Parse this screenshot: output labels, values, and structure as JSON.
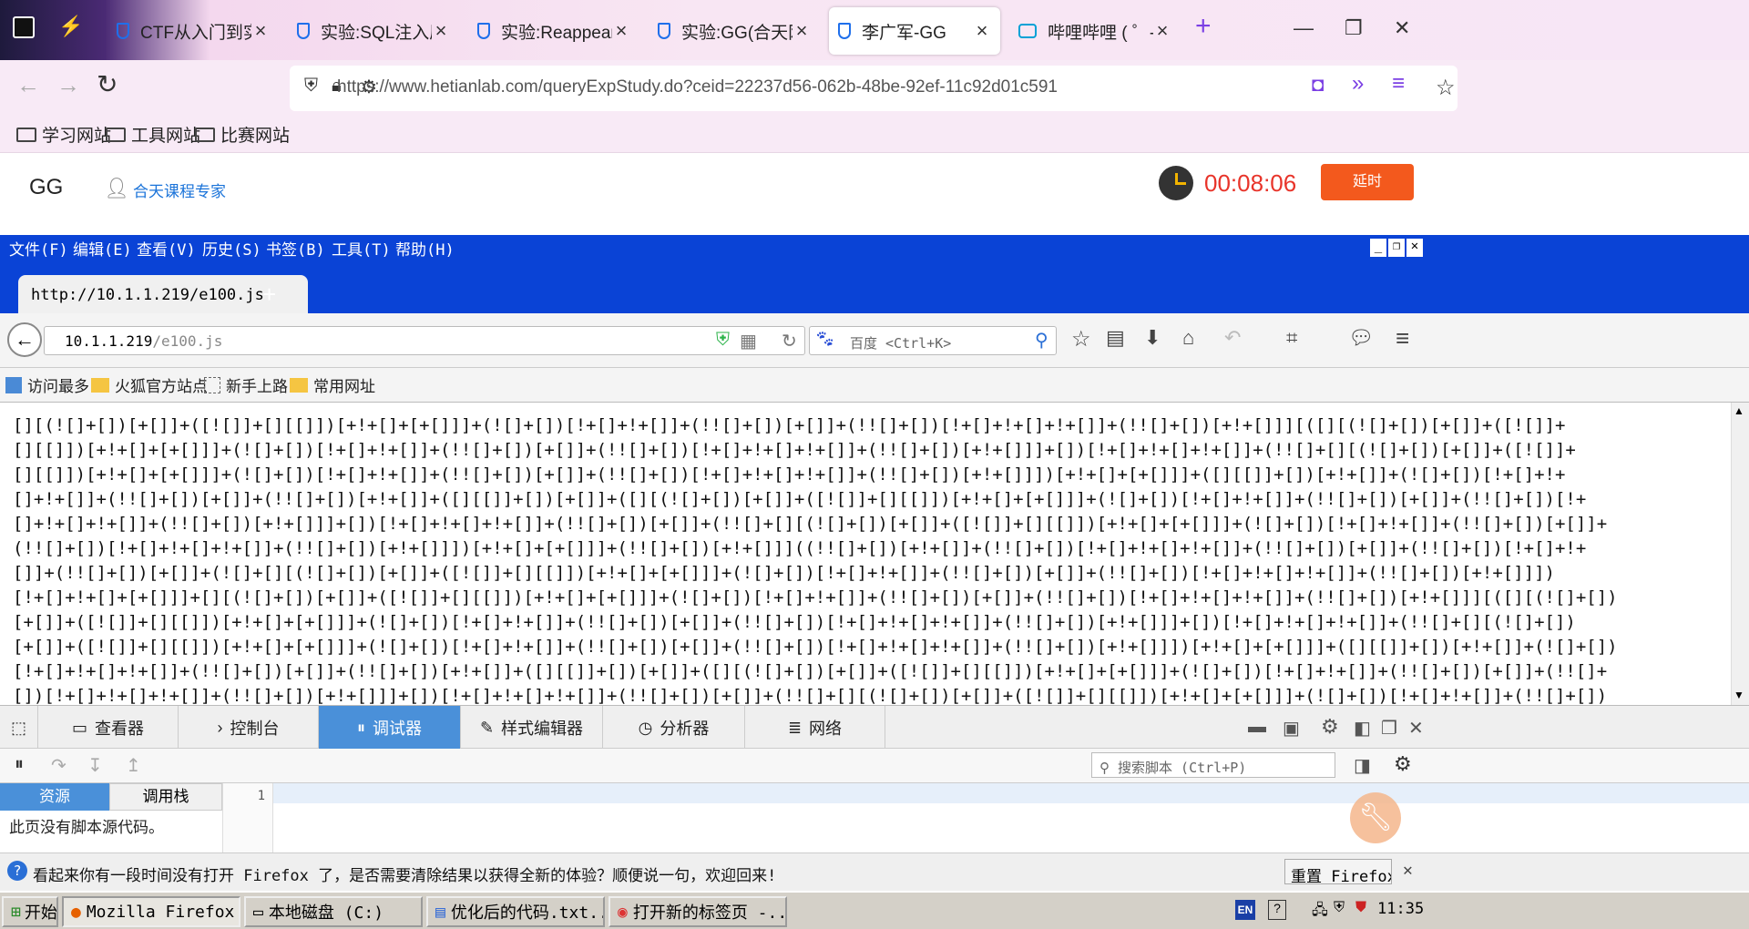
{
  "outer_tabs": [
    {
      "label": "CTF从入门到实践-("
    },
    {
      "label": "实验:SQL注入原理与"
    },
    {
      "label": "实验:Reappear(合天"
    },
    {
      "label": "实验:GG(合天网安实"
    },
    {
      "label": "李广军-GG"
    },
    {
      "label": "哔哩哔哩 ( ゜- ゜)つ"
    }
  ],
  "outer_url": "https://www.hetianlab.com/queryExpStudy.do?ceid=22237d56-062b-48be-92ef-11c92d01c591",
  "outer_bookmarks": [
    "学习网站",
    "工具网站",
    "比赛网站"
  ],
  "lab_header": {
    "title": "GG",
    "expert": "合天课程专家",
    "timer": "00:08:06",
    "extend_button": "延时"
  },
  "inner_menu": [
    "文件(F)",
    "编辑(E)",
    "查看(V)",
    "历史(S)",
    "书签(B)",
    "工具(T)",
    "帮助(H)"
  ],
  "inner_tab": "http://10.1.1.219/e100.js",
  "inner_url_host": "10.1.1.219",
  "inner_url_path": "/e100.js",
  "inner_search_engine": "百度",
  "inner_search_placeholder": "百度 <Ctrl+K>",
  "inner_bookmarks": [
    "访问最多",
    "火狐官方站点",
    "新手上路",
    "常用网址"
  ],
  "page_code": [
    "[][(![]+[])[+[]]+([![]]+[][[]])[+!+[]+[+[]]]+(![]+[])[!+[]+!+[]]+(!![]+[])[+[]]+(!![]+[])[!+[]+!+[]+!+[]]+(!![]+[])[+!+[]]][([][(![]+[])[+[]]+([![]]+",
    "[][[]])[+!+[]+[+[]]]+(![]+[])[!+[]+!+[]]+(!![]+[])[+[]]+(!![]+[])[!+[]+!+[]+!+[]]+(!![]+[])[+!+[]]]+[])[!+[]+!+[]+!+[]]+(!![]+[][(![]+[])[+[]]+([![]]+",
    "[][[]])[+!+[]+[+[]]]+(![]+[])[!+[]+!+[]]+(!![]+[])[+[]]+(!![]+[])[!+[]+!+[]+!+[]]+(!![]+[])[+!+[]]])[+!+[]+[+[]]]+([][[]]+[])[+!+[]]+(![]+[])[!+[]+!+",
    "[]+!+[]]+(!![]+[])[+[]]+(!![]+[])[+!+[]]+([][[]]+[])[+[]]+([][(![]+[])[+[]]+([![]]+[][[]])[+!+[]+[+[]]]+(![]+[])[!+[]+!+[]]+(!![]+[])[+[]]+(!![]+[])[!+",
    "[]+!+[]+!+[]]+(!![]+[])[+!+[]]]+[])[!+[]+!+[]+!+[]]+(!![]+[])[+[]]+(!![]+[][(![]+[])[+[]]+([![]]+[][[]])[+!+[]+[+[]]]+(![]+[])[!+[]+!+[]]+(!![]+[])[+[]]+",
    "(!![]+[])[!+[]+!+[]+!+[]]+(!![]+[])[+!+[]]])[+!+[]+[+[]]]+(!![]+[])[+!+[]]]((!![]+[])[+!+[]]+(!![]+[])[!+[]+!+[]+!+[]]+(!![]+[])[+[]]+(!![]+[])[!+[]+!+",
    "[]]+(!![]+[])[+[]]+(![]+[][(![]+[])[+[]]+([![]]+[][[]])[+!+[]+[+[]]]+(![]+[])[!+[]+!+[]]+(!![]+[])[+[]]+(!![]+[])[!+[]+!+[]+!+[]]+(!![]+[])[+!+[]]])",
    "[!+[]+!+[]+[+[]]]+[][(![]+[])[+[]]+([![]]+[][[]])[+!+[]+[+[]]]+(![]+[])[!+[]+!+[]]+(!![]+[])[+[]]+(!![]+[])[!+[]+!+[]+!+[]]+(!![]+[])[+!+[]]][([][(![]+[])",
    "[+[]]+([![]]+[][[]])[+!+[]+[+[]]]+(![]+[])[!+[]+!+[]]+(!![]+[])[+[]]+(!![]+[])[!+[]+!+[]+!+[]]+(!![]+[])[+!+[]]]+[])[!+[]+!+[]+!+[]]+(!![]+[][(![]+[])",
    "[+[]]+([![]]+[][[]])[+!+[]+[+[]]]+(![]+[])[!+[]+!+[]]+(!![]+[])[+[]]+(!![]+[])[!+[]+!+[]+!+[]]+(!![]+[])[+!+[]]])[+!+[]+[+[]]]+([][[]]+[])[+!+[]]+(![]+[])",
    "[!+[]+!+[]+!+[]]+(!![]+[])[+[]]+(!![]+[])[+!+[]]+([][[]]+[])[+[]]+([][(![]+[])[+[]]+([![]]+[][[]])[+!+[]+[+[]]]+(![]+[])[!+[]+!+[]]+(!![]+[])[+[]]+(!![]+",
    "[])[!+[]+!+[]+!+[]]+(!![]+[])[+!+[]]]+[])[!+[]+!+[]+!+[]]+(!![]+[])[+[]]+(!![]+[][(![]+[])[+[]]+([![]]+[][[]])[+!+[]+[+[]]]+(![]+[])[!+[]+!+[]]+(!![]+[])"
  ],
  "devtools_tabs": [
    "查看器",
    "控制台",
    "调试器",
    "样式编辑器",
    "分析器",
    "网络"
  ],
  "devtools_search_placeholder": "搜索脚本 (Ctrl+P)",
  "devtools_side_tabs": [
    "资源",
    "调用栈"
  ],
  "devtools_no_source": "此页没有脚本源代码。",
  "devtools_line_number": "1",
  "notice_text": "看起来你有一段时间没有打开 Firefox 了，是否需要清除结果以获得全新的体验？顺便说一句，欢迎回来!",
  "notice_button": "重置 Firefox…",
  "taskbar": {
    "start": "开始",
    "items": [
      "Mozilla Firefox",
      "本地磁盘 (C:)",
      "优化后的代码.txt...",
      "打开新的标签页 -..."
    ],
    "lang": "EN",
    "clock": "11:35"
  },
  "colors": {
    "timer": "#e8342a",
    "extend": "#f3591d",
    "inner_chrome": "#0a43d6",
    "debugger_tab": "#4a90d9"
  }
}
